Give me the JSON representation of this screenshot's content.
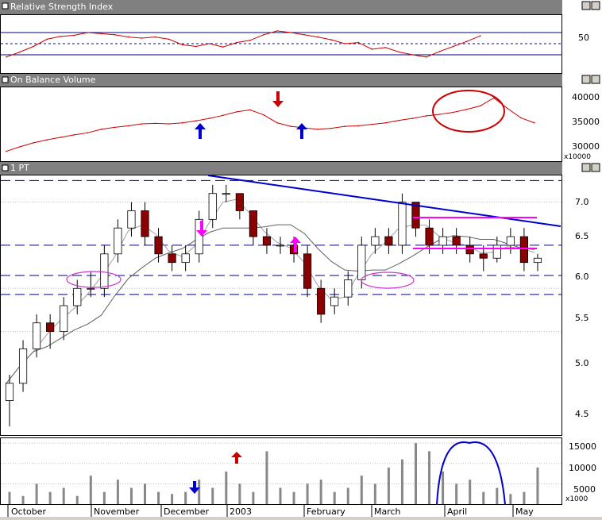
{
  "panels": {
    "rsi": {
      "title": "Relative Strength Index",
      "ticks": [
        "50"
      ]
    },
    "obv": {
      "title": "On Balance Volume",
      "ticks": [
        "40000",
        "35000",
        "30000"
      ],
      "multiplier": "x10000"
    },
    "price": {
      "title": "1 PT",
      "ticks": [
        "7.0",
        "6.5",
        "6.0",
        "5.5",
        "5.0",
        "4.5"
      ]
    },
    "volume": {
      "ticks": [
        "15000",
        "10000",
        "5000"
      ],
      "multiplier": "x1000"
    }
  },
  "months": [
    "October",
    "November",
    "December",
    "2003",
    "February",
    "March",
    "April",
    "May"
  ],
  "colors": {
    "up_candle": "#ffffff",
    "down_candle": "#8b0000",
    "rsi_line": "#cc0000",
    "obv_line": "#cc0000",
    "trendline": "#0000cc",
    "channel": "#ff00ff",
    "support": "#000080",
    "ma_fast": "#a0a0a0",
    "ma_slow": "#606060",
    "ma_tan": "#999933"
  },
  "chart_data": [
    {
      "type": "line",
      "panel": "rsi",
      "ylim": [
        0,
        100
      ],
      "hlines": [
        30,
        50,
        70
      ],
      "x": [
        0,
        4,
        8,
        12,
        16,
        20,
        24,
        28,
        32,
        36,
        40,
        44,
        48,
        52,
        56,
        60,
        64,
        68,
        72,
        76,
        80,
        84,
        88,
        92,
        96,
        100,
        104,
        108,
        112,
        116,
        120,
        124,
        128,
        132,
        136,
        140
      ],
      "values": [
        26,
        35,
        45,
        58,
        63,
        65,
        70,
        68,
        66,
        62,
        60,
        62,
        58,
        48,
        45,
        50,
        44,
        52,
        56,
        66,
        73,
        70,
        66,
        62,
        57,
        50,
        52,
        40,
        43,
        35,
        30,
        26,
        36,
        45,
        54,
        64
      ]
    },
    {
      "type": "line",
      "panel": "obv",
      "ylim": [
        28000,
        42000
      ],
      "x": [
        0,
        4,
        8,
        12,
        16,
        20,
        24,
        28,
        32,
        36,
        40,
        44,
        48,
        52,
        56,
        60,
        64,
        68,
        72,
        76,
        80,
        84,
        88,
        92,
        96,
        100,
        104,
        108,
        112,
        116,
        120,
        124,
        128,
        132,
        136,
        140,
        144,
        148,
        152,
        156
      ],
      "values": [
        29500,
        30400,
        31200,
        31800,
        32300,
        32800,
        33200,
        33900,
        34300,
        34600,
        35000,
        35100,
        35000,
        35200,
        35600,
        36100,
        36700,
        37400,
        37800,
        36800,
        35200,
        34500,
        34200,
        33900,
        34100,
        34500,
        34600,
        34900,
        35200,
        35700,
        36100,
        36600,
        36900,
        37300,
        37900,
        38600,
        40200,
        38100,
        36200,
        35200
      ]
    },
    {
      "type": "candlestick",
      "panel": "price",
      "ylim": [
        4.3,
        7.3
      ],
      "x": [
        0,
        4,
        8,
        12,
        16,
        20,
        24,
        28,
        32,
        36,
        40,
        44,
        48,
        52,
        56,
        60,
        64,
        68,
        72,
        76,
        80,
        84,
        88,
        92,
        96,
        100,
        104,
        108,
        112,
        116,
        120,
        124,
        128,
        132,
        136,
        140,
        144,
        148,
        152,
        156
      ],
      "open": [
        4.7,
        4.9,
        5.3,
        5.6,
        5.5,
        5.8,
        6.0,
        6.0,
        6.4,
        6.7,
        6.9,
        6.6,
        6.4,
        6.3,
        6.4,
        6.8,
        7.1,
        7.1,
        6.9,
        6.6,
        6.5,
        6.5,
        6.4,
        6.0,
        5.8,
        5.9,
        6.1,
        6.5,
        6.6,
        6.5,
        7.0,
        6.7,
        6.5,
        6.6,
        6.5,
        6.4,
        6.35,
        6.5,
        6.6,
        6.3
      ],
      "close": [
        4.9,
        5.3,
        5.6,
        5.5,
        5.8,
        6.0,
        6.0,
        6.4,
        6.7,
        6.9,
        6.6,
        6.4,
        6.3,
        6.4,
        6.8,
        7.1,
        7.1,
        6.9,
        6.6,
        6.5,
        6.5,
        6.4,
        6.0,
        5.7,
        5.9,
        6.1,
        6.5,
        6.6,
        6.5,
        7.0,
        6.7,
        6.5,
        6.6,
        6.5,
        6.4,
        6.35,
        6.5,
        6.6,
        6.3,
        6.35
      ],
      "high": [
        5.0,
        5.4,
        5.7,
        5.7,
        5.9,
        6.1,
        6.2,
        6.5,
        6.8,
        7.0,
        7.0,
        6.7,
        6.5,
        6.5,
        6.9,
        7.2,
        7.2,
        7.1,
        6.9,
        6.7,
        6.6,
        6.6,
        6.5,
        6.1,
        6.0,
        6.2,
        6.6,
        6.7,
        6.7,
        7.1,
        7.0,
        6.8,
        6.7,
        6.7,
        6.6,
        6.5,
        6.6,
        6.7,
        6.7,
        6.4
      ],
      "low": [
        4.4,
        4.8,
        5.2,
        5.3,
        5.4,
        5.7,
        5.9,
        5.9,
        6.3,
        6.6,
        6.5,
        6.3,
        6.2,
        6.2,
        6.3,
        6.7,
        7.0,
        6.8,
        6.5,
        6.4,
        6.4,
        6.3,
        5.9,
        5.6,
        5.7,
        5.8,
        6.0,
        6.4,
        6.4,
        6.4,
        6.6,
        6.4,
        6.4,
        6.4,
        6.3,
        6.2,
        6.3,
        6.4,
        6.2,
        6.2
      ]
    },
    {
      "type": "bar",
      "panel": "volume",
      "ylim": [
        0,
        16000
      ],
      "x": [
        0,
        4,
        8,
        12,
        16,
        20,
        24,
        28,
        32,
        36,
        40,
        44,
        48,
        52,
        56,
        60,
        64,
        68,
        72,
        76,
        80,
        84,
        88,
        92,
        96,
        100,
        104,
        108,
        112,
        116,
        120,
        124,
        128,
        132,
        136,
        140,
        144,
        148,
        152,
        156
      ],
      "values": [
        3000,
        2000,
        5000,
        3000,
        4000,
        2000,
        7000,
        3000,
        6000,
        4000,
        5000,
        3000,
        2500,
        3000,
        6000,
        4000,
        8000,
        5000,
        3000,
        13000,
        4000,
        3000,
        5000,
        6000,
        3000,
        4000,
        7000,
        5000,
        9000,
        11000,
        15000,
        13000,
        8000,
        5000,
        6000,
        3000,
        4000,
        2500,
        3000,
        9000
      ]
    }
  ]
}
